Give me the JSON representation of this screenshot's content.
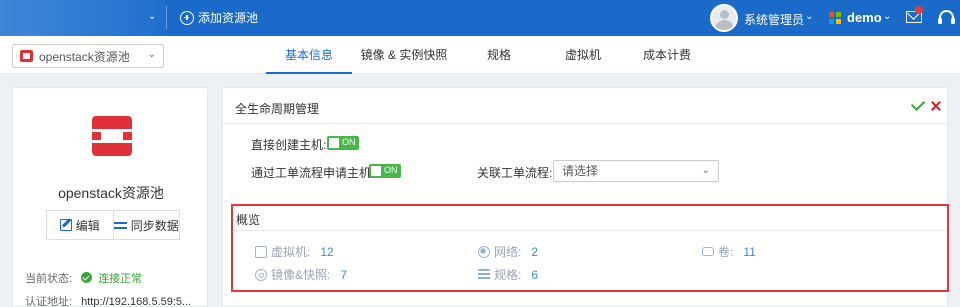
{
  "topbar": {
    "add_pool_label": "添加资源池",
    "user_name": "系统管理员",
    "project_name": "demo",
    "caret": "⌄"
  },
  "subbar": {
    "pool_select_value": "openstack资源池",
    "tabs": [
      {
        "label": "基本信息",
        "active": true
      },
      {
        "label": "镜像 & 实例快照",
        "active": false
      },
      {
        "label": "规格",
        "active": false
      },
      {
        "label": "虚拟机",
        "active": false
      },
      {
        "label": "成本计费",
        "active": false
      }
    ]
  },
  "left": {
    "pool_name": "openstack资源池",
    "edit_label": "编辑",
    "sync_label": "同步数据",
    "status_label": "当前状态:",
    "status_value": "连接正常",
    "auth_label": "认证地址:",
    "auth_value": "http://192.168.5.59:5..."
  },
  "panel": {
    "title": "全生命周期管理",
    "direct_create_label": "直接创建主机:",
    "workflow_create_label": "通过工单流程申请主机:",
    "toggle_on": "ON",
    "workflow_link_label": "关联工单流程:",
    "workflow_select_value": "请选择"
  },
  "overview": {
    "title": "概览",
    "stats": {
      "vm": {
        "label": "虚拟机:",
        "value": "12"
      },
      "network": {
        "label": "网络:",
        "value": "2"
      },
      "volume": {
        "label": "卷:",
        "value": "11"
      },
      "image": {
        "label": "镜像&快照:",
        "value": "7"
      },
      "spec": {
        "label": "规格:",
        "value": "6"
      }
    }
  },
  "colors": {
    "primary": "#1a6bc9",
    "ok_green": "#3aa53a",
    "highlight_red": "#e2363a",
    "openstack_red": "#e0303a"
  }
}
